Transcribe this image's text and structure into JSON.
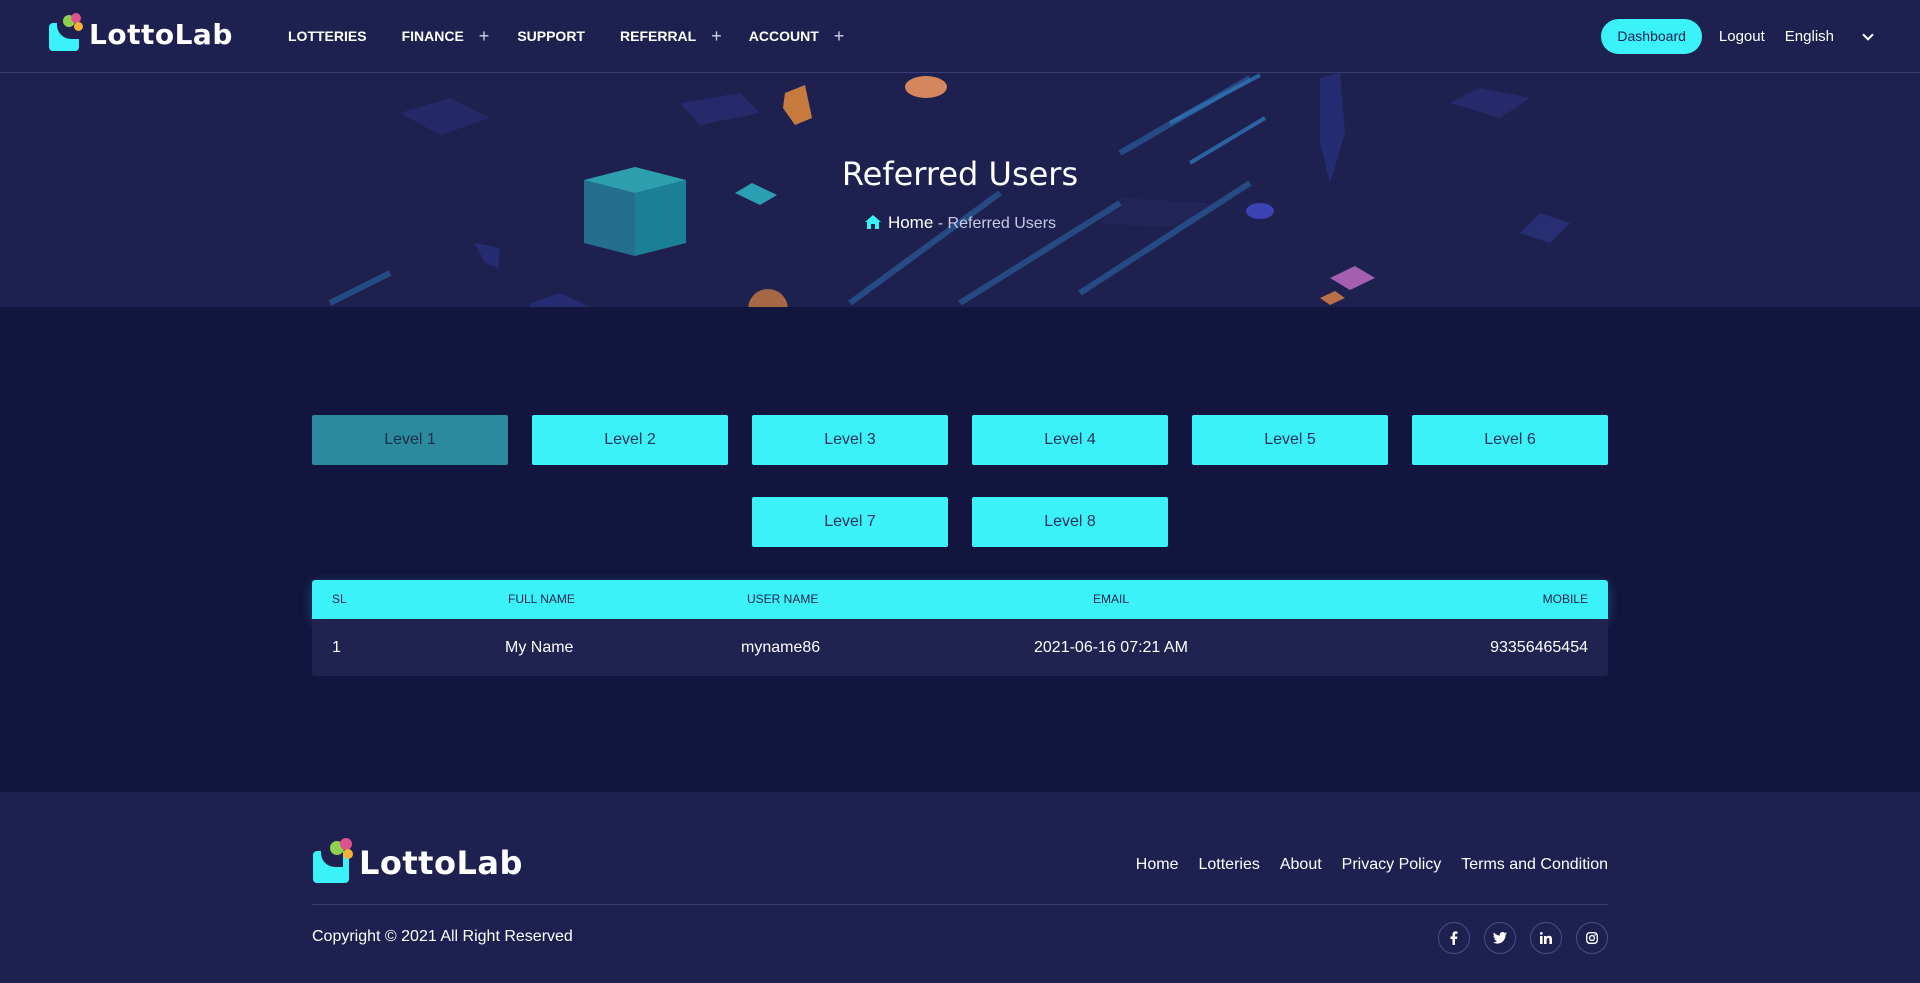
{
  "brand": {
    "name": "LottoLab"
  },
  "nav": {
    "items": [
      {
        "label": "LOTTERIES",
        "plus": false
      },
      {
        "label": "FINANCE",
        "plus": true
      },
      {
        "label": "SUPPORT",
        "plus": false
      },
      {
        "label": "REFERRAL",
        "plus": true
      },
      {
        "label": "ACCOUNT",
        "plus": true
      }
    ],
    "plus_glyph": "+"
  },
  "header": {
    "dashboard_label": "Dashboard",
    "logout_label": "Logout",
    "language": "English"
  },
  "banner": {
    "title": "Referred Users",
    "breadcrumb_home": "Home",
    "breadcrumb_sep": "-",
    "breadcrumb_current": "Referred Users"
  },
  "levels": [
    "Level 1",
    "Level 2",
    "Level 3",
    "Level 4",
    "Level 5",
    "Level 6",
    "Level 7",
    "Level 8"
  ],
  "active_level": "Level 1",
  "table": {
    "columns": [
      "SL",
      "FULL NAME",
      "USER NAME",
      "EMAIL",
      "MOBILE"
    ],
    "rows": [
      [
        "1",
        "My Name",
        "myname86",
        "2021-06-16 07:21 AM",
        "93356465454"
      ]
    ]
  },
  "footer": {
    "links": [
      "Home",
      "Lotteries",
      "About",
      "Privacy Policy",
      "Terms and Condition"
    ],
    "copyright": "Copyright © 2021 All Right Reserved",
    "socials": [
      "facebook-icon",
      "twitter-icon",
      "linkedin-icon",
      "instagram-icon"
    ]
  },
  "colors": {
    "accent": "#3af2f8",
    "header_bg": "#1e2150",
    "page_bg": "#12153e",
    "active_level": "#2c8a9e"
  }
}
